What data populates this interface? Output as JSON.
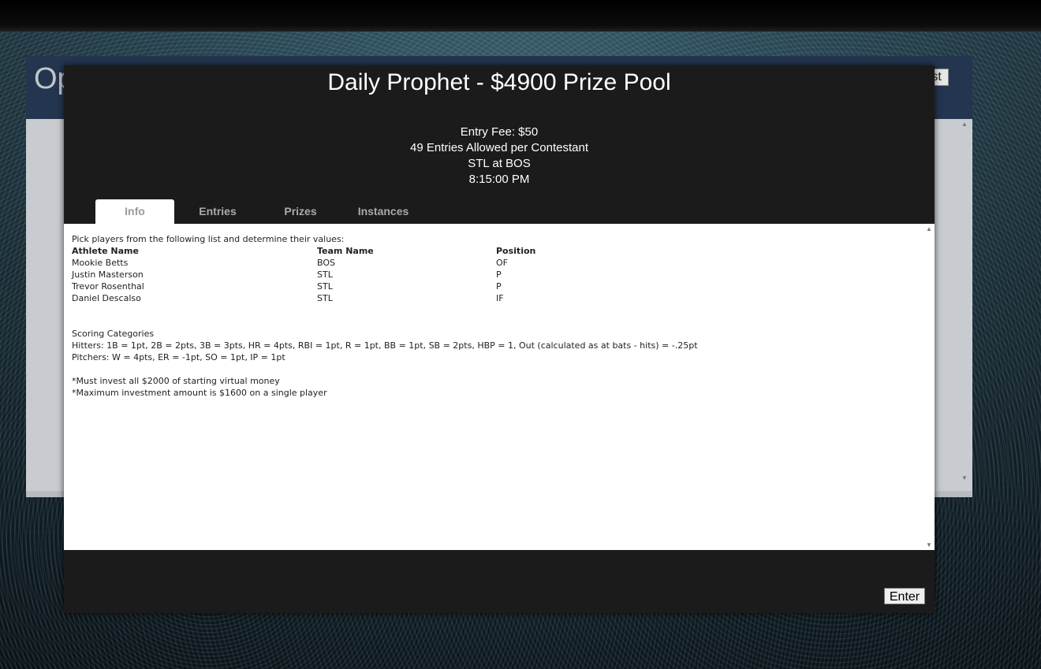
{
  "background": {
    "page_title": "Op",
    "button_label": "test"
  },
  "modal": {
    "title": "Daily Prophet - $4900 Prize Pool",
    "entry_fee": "Entry Fee: $50",
    "entries_allowed": "49 Entries Allowed per Contestant",
    "matchup": "STL at BOS",
    "time": "8:15:00 PM",
    "tabs": [
      {
        "label": "Info",
        "active": true
      },
      {
        "label": "Entries",
        "active": false
      },
      {
        "label": "Prizes",
        "active": false
      },
      {
        "label": "Instances",
        "active": false
      }
    ],
    "info": {
      "intro": "Pick players from the following list and determine their values:",
      "columns": [
        "Athlete Name",
        "Team Name",
        "Position"
      ],
      "athletes": [
        {
          "name": "Mookie Betts",
          "team": "BOS",
          "position": "OF"
        },
        {
          "name": "Justin Masterson",
          "team": "STL",
          "position": "P"
        },
        {
          "name": "Trevor Rosenthal",
          "team": "STL",
          "position": "P"
        },
        {
          "name": "Daniel Descalso",
          "team": "STL",
          "position": "IF"
        }
      ],
      "scoring_title": "Scoring Categories",
      "hitters": "Hitters: 1B = 1pt, 2B = 2pts, 3B = 3pts, HR = 4pts, RBI = 1pt, R = 1pt, BB = 1pt, SB = 2pts, HBP = 1, Out (calculated as at bats - hits) = -.25pt",
      "pitchers": "Pitchers: W = 4pts, ER = -1pt, SO = 1pt, IP = 1pt",
      "rule_1": "*Must invest all $2000 of starting virtual money",
      "rule_2": "*Maximum investment amount is $1600 on a single player"
    },
    "enter_label": "Enter"
  }
}
